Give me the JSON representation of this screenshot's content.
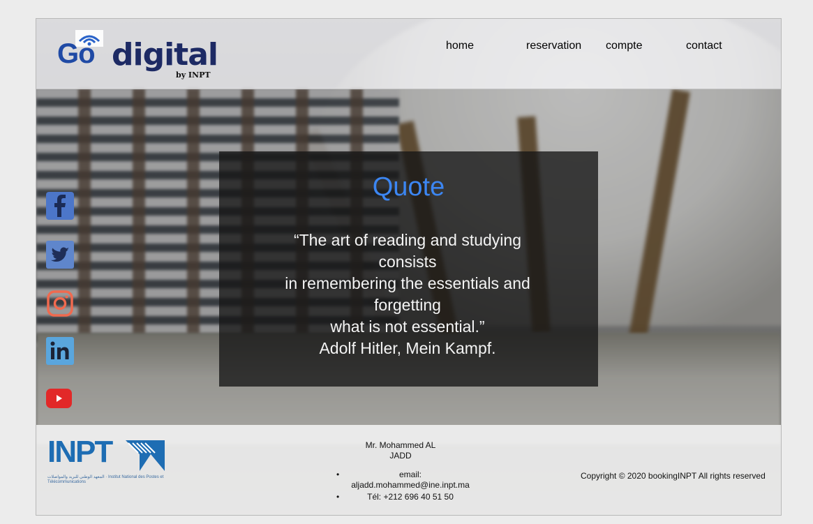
{
  "logo": {
    "go": "Go",
    "digital": "digital",
    "by": "by INPT"
  },
  "nav": [
    {
      "label": "home"
    },
    {
      "label": "reservation"
    },
    {
      "label": "compte"
    },
    {
      "label": "contact"
    }
  ],
  "quote": {
    "title": "Quote",
    "text": "“The art of reading and studying consists\nin remembering the essentials and forgetting\nwhat is not essential.”\nAdolf Hitler, Mein Kampf."
  },
  "social": [
    {
      "icon": "facebook-icon",
      "color": "#4c76c9"
    },
    {
      "icon": "twitter-icon",
      "color": "#5f86cc"
    },
    {
      "icon": "instagram-icon",
      "color": "#f06a4f"
    },
    {
      "icon": "linkedin-icon",
      "color": "#5aa6dd"
    },
    {
      "icon": "youtube-icon",
      "color": "#e22828"
    }
  ],
  "footer": {
    "inpt_logo": "INPT",
    "inpt_sub": "المعهد الوطني للبريد والمواصلات · Institut National des Postes et Télécommunications",
    "contact_name": "Mr. Mohammed AL JADD",
    "email": "email: aljadd.mohammed@ine.inpt.ma",
    "tel": "Tél: +212 696 40 51 50",
    "bullet": "•",
    "copyright": "Copyright © 2020 bookingINPT All rights reserved"
  },
  "colors": {
    "accent": "#3c86f2",
    "nav": "#2b5fd8"
  }
}
